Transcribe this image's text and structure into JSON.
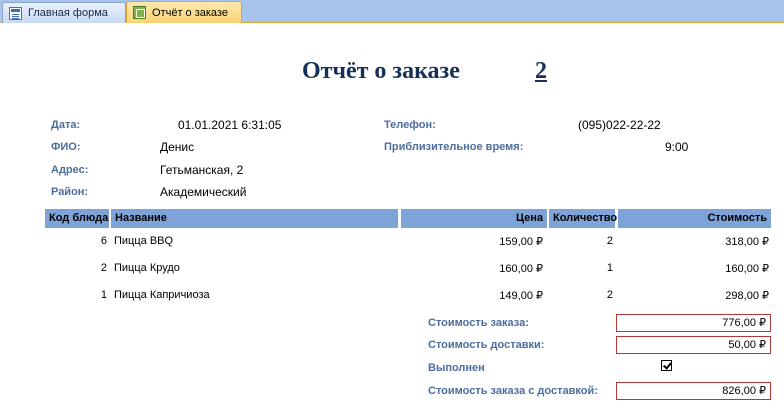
{
  "tabs": [
    {
      "label": "Главная форма",
      "icon": "form-icon"
    },
    {
      "label": "Отчёт о заказе",
      "icon": "report-icon"
    }
  ],
  "report": {
    "title": "Отчёт о заказе",
    "order_number": "2"
  },
  "fields": {
    "date": {
      "label": "Дата:",
      "value": "01.01.2021 6:31:05"
    },
    "name": {
      "label": "ФИО:",
      "value": "Денис"
    },
    "address": {
      "label": "Адрес:",
      "value": "Гетьманская, 2"
    },
    "district": {
      "label": "Район:",
      "value": "Академический"
    },
    "phone": {
      "label": "Телефон:",
      "value": "(095)022-22-22"
    },
    "approx_time": {
      "label": "Приблизительное время:",
      "value": "9:00"
    }
  },
  "table": {
    "columns": [
      "Код блюда",
      "Название",
      "Цена",
      "Количество",
      "Стоимость"
    ],
    "rows": [
      {
        "code": "6",
        "name": "Пицца BBQ",
        "price": "159,00 ₽",
        "qty": "2",
        "cost": "318,00 ₽"
      },
      {
        "code": "2",
        "name": "Пицца Крудо",
        "price": "160,00 ₽",
        "qty": "1",
        "cost": "160,00 ₽"
      },
      {
        "code": "1",
        "name": "Пицца Капричиоза",
        "price": "149,00 ₽",
        "qty": "2",
        "cost": "298,00 ₽"
      }
    ]
  },
  "totals": {
    "order_cost": {
      "label": "Стоимость заказа:",
      "value": "776,00 ₽"
    },
    "delivery_cost": {
      "label": "Стоимость доставки:",
      "value": "50,00 ₽"
    },
    "completed": {
      "label": "Выполнен",
      "checked": true
    },
    "total_with_delivery": {
      "label": "Стоимость заказа с доставкой:",
      "value": "826,00 ₽"
    }
  },
  "colors": {
    "tabstrip": "#a9c4ea",
    "active_tab": "#fbd274",
    "header_row": "#7da3d8",
    "label": "#4d6d9e",
    "title": "#16305a",
    "box_border": "#b03a3a"
  }
}
